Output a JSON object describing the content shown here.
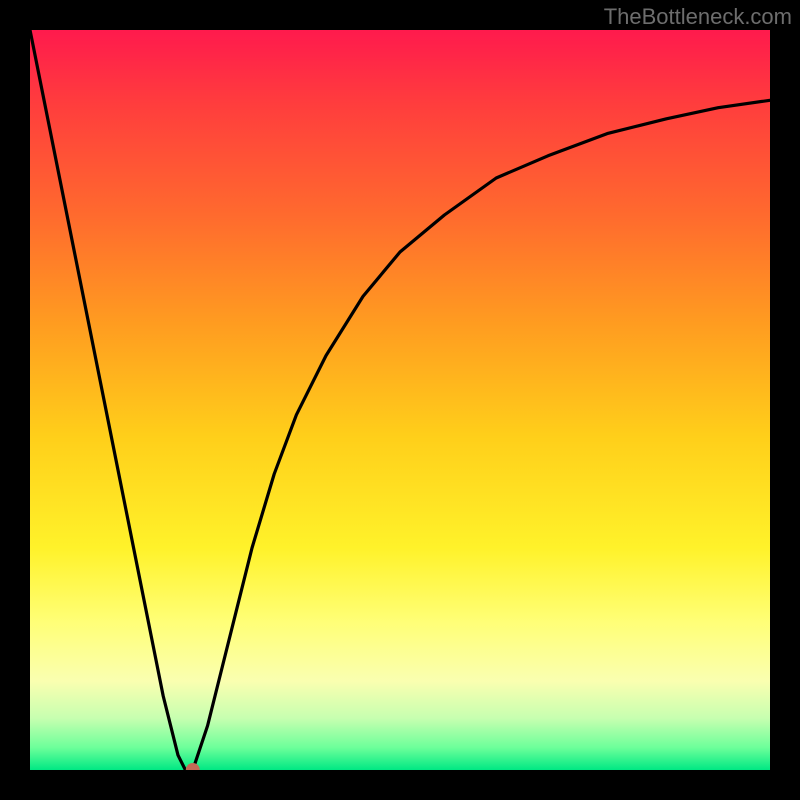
{
  "watermark": "TheBottleneck.com",
  "chart_data": {
    "type": "line",
    "title": "",
    "xlabel": "",
    "ylabel": "",
    "ylim": [
      0,
      100
    ],
    "xlim": [
      0,
      100
    ],
    "series": [
      {
        "name": "bottleneck-curve",
        "x": [
          0,
          2,
          4,
          6,
          8,
          10,
          12,
          14,
          16,
          18,
          20,
          21,
          22,
          24,
          26,
          28,
          30,
          33,
          36,
          40,
          45,
          50,
          56,
          63,
          70,
          78,
          86,
          93,
          100
        ],
        "y": [
          100,
          90,
          80,
          70,
          60,
          50,
          40,
          30,
          20,
          10,
          2,
          0,
          0,
          6,
          14,
          22,
          30,
          40,
          48,
          56,
          64,
          70,
          75,
          80,
          83,
          86,
          88,
          89.5,
          90.5
        ]
      }
    ],
    "marker": {
      "x": 22,
      "y": 0,
      "color": "#c46a57"
    },
    "gradient_stops": [
      {
        "pos": 0,
        "color": "#ff1a4d"
      },
      {
        "pos": 0.5,
        "color": "#ffd21a"
      },
      {
        "pos": 0.9,
        "color": "#faff99"
      },
      {
        "pos": 1,
        "color": "#00e884"
      }
    ]
  }
}
